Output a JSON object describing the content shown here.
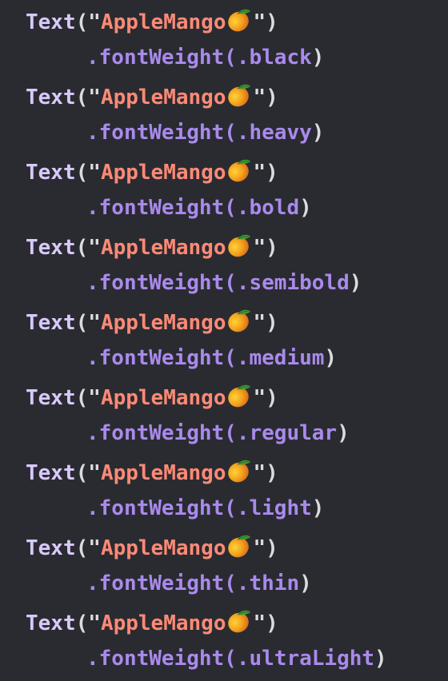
{
  "code": {
    "call_name": "Text",
    "open_quote": "(\"",
    "string_text": "AppleMango",
    "close_quote": "\")",
    "mango_icon": "mango-emoji-icon",
    "modifier_prefix": ".fontWeight(",
    "modifier_suffix": ")",
    "weights": [
      ".black",
      ".heavy",
      ".bold",
      ".semibold",
      ".medium",
      ".regular",
      ".light",
      ".thin",
      ".ultraLight"
    ]
  },
  "colors": {
    "background": "#2a2b31",
    "identifier": "#d9c9fb",
    "keyword": "#a98aec",
    "string": "#fc8a76",
    "punctuation": "#dcdcdf"
  }
}
